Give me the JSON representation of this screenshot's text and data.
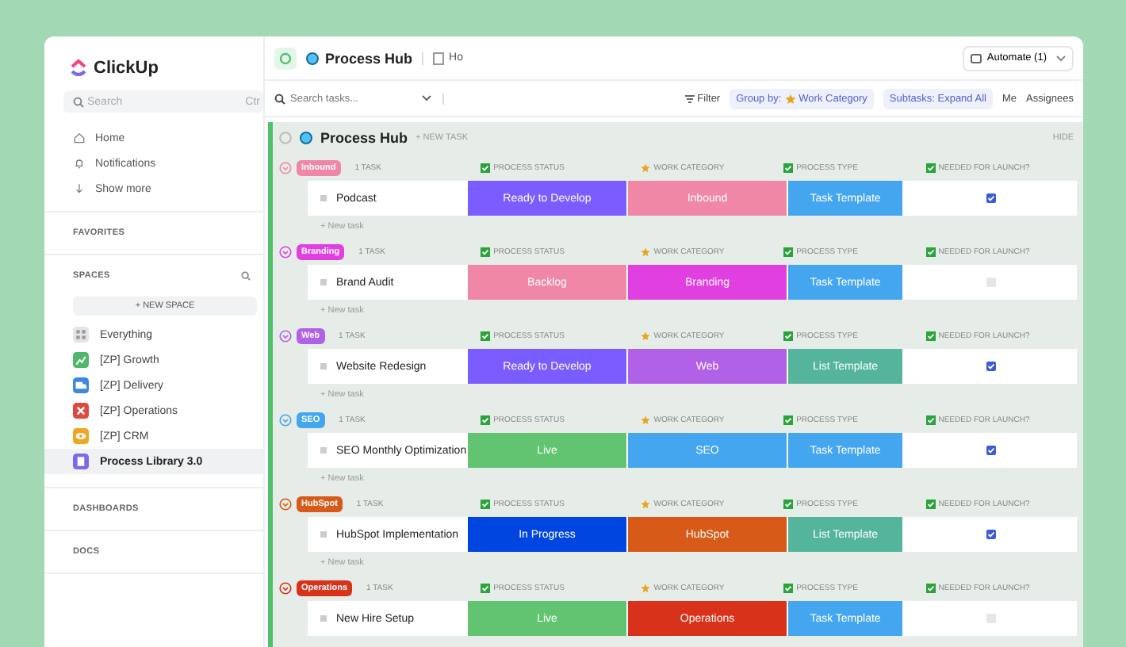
{
  "sidebar": {
    "logo": "ClickUp",
    "search": {
      "placeholder": "Search",
      "shortcut": "Ctr"
    },
    "nav": [
      {
        "kind": "home",
        "label": "Home"
      },
      {
        "kind": "bell",
        "label": "Notifications"
      },
      {
        "kind": "more",
        "label": "Show more"
      }
    ],
    "favorites_heading": "FAVORITES",
    "spaces_heading": "SPACES",
    "new_space": "+ NEW SPACE",
    "spaces": [
      {
        "kind": "grid",
        "label": "Everything",
        "color": "#e3e5ea",
        "selected": false
      },
      {
        "kind": "chart",
        "label": "[ZP] Growth",
        "color": "#4fb76b",
        "selected": false
      },
      {
        "kind": "truck",
        "label": "[ZP] Delivery",
        "color": "#3d88e0",
        "selected": false
      },
      {
        "kind": "cross",
        "label": "[ZP] Operations",
        "color": "#e0493f",
        "selected": false
      },
      {
        "kind": "eye",
        "label": "[ZP] CRM",
        "color": "#f0a623",
        "selected": false
      },
      {
        "kind": "doc",
        "label": "Process Library 3.0",
        "color": "#7b68ee",
        "selected": true
      }
    ],
    "dashboards_heading": "DASHBOARDS",
    "docs_heading": "DOCS"
  },
  "header": {
    "title": "Process Hub",
    "tab": "Ho",
    "automate": "Automate (1)"
  },
  "toolbar": {
    "search": {
      "placeholder": "Search tasks..."
    },
    "filter": "Filter",
    "group_by": {
      "label": "Group by:",
      "value": "Work Category"
    },
    "subtasks": "Subtasks: Expand All",
    "me": "Me",
    "assignees": "Assignees"
  },
  "list": {
    "title": "Process Hub",
    "new_task": "+ NEW TASK",
    "hide": "HIDE"
  },
  "groups": [
    {
      "name": "Inbound",
      "color": "#f087a7",
      "count": "1 TASK",
      "columns": [
        "PROCESS STATUS",
        "WORK CATEGORY",
        "PROCESS TYPE",
        "NEEDED FOR LAUNCH?"
      ],
      "tasks": [
        {
          "name": "Podcast",
          "status": {
            "label": "Ready to Develop",
            "color": "#7b5cff"
          },
          "category": {
            "label": "Inbound",
            "color": "#f087a7"
          },
          "type": {
            "label": "Task Template",
            "color": "#45a6f0"
          },
          "needed": true
        }
      ],
      "add": "+ New task"
    },
    {
      "name": "Branding",
      "color": "#e040e0",
      "count": "1 TASK",
      "columns": [
        "PROCESS STATUS",
        "WORK CATEGORY",
        "PROCESS TYPE",
        "NEEDED FOR LAUNCH?"
      ],
      "tasks": [
        {
          "name": "Brand Audit",
          "status": {
            "label": "Backlog",
            "color": "#f087a7"
          },
          "category": {
            "label": "Branding",
            "color": "#e040e0"
          },
          "type": {
            "label": "Task Template",
            "color": "#45a6f0"
          },
          "needed": false
        }
      ],
      "add": "+ New task"
    },
    {
      "name": "Web",
      "color": "#b061e8",
      "count": "1 TASK",
      "columns": [
        "PROCESS STATUS",
        "WORK CATEGORY",
        "PROCESS TYPE",
        "NEEDED FOR LAUNCH?"
      ],
      "tasks": [
        {
          "name": "Website Redesign",
          "status": {
            "label": "Ready to Develop",
            "color": "#7b5cff"
          },
          "category": {
            "label": "Web",
            "color": "#b061e8"
          },
          "type": {
            "label": "List Template",
            "color": "#55b59c"
          },
          "needed": true
        }
      ],
      "add": "+ New task"
    },
    {
      "name": "SEO",
      "color": "#45a6f0",
      "count": "1 TASK",
      "columns": [
        "PROCESS STATUS",
        "WORK CATEGORY",
        "PROCESS TYPE",
        "NEEDED FOR LAUNCH?"
      ],
      "tasks": [
        {
          "name": "SEO Monthly Optimization",
          "status": {
            "label": "Live",
            "color": "#62c370"
          },
          "category": {
            "label": "SEO",
            "color": "#45a6f0"
          },
          "type": {
            "label": "Task Template",
            "color": "#45a6f0"
          },
          "needed": true
        }
      ],
      "add": "+ New task"
    },
    {
      "name": "HubSpot",
      "color": "#d85a18",
      "count": "1 TASK",
      "columns": [
        "PROCESS STATUS",
        "WORK CATEGORY",
        "PROCESS TYPE",
        "NEEDED FOR LAUNCH?"
      ],
      "tasks": [
        {
          "name": "HubSpot Implementation",
          "status": {
            "label": "In Progress",
            "color": "#0045e0"
          },
          "category": {
            "label": "HubSpot",
            "color": "#d85a18"
          },
          "type": {
            "label": "List Template",
            "color": "#55b59c"
          },
          "needed": true
        }
      ],
      "add": "+ New task"
    },
    {
      "name": "Operations",
      "color": "#d8321a",
      "count": "1 TASK",
      "columns": [
        "PROCESS STATUS",
        "WORK CATEGORY",
        "PROCESS TYPE",
        "NEEDED FOR LAUNCH?"
      ],
      "tasks": [
        {
          "name": "New Hire Setup",
          "status": {
            "label": "Live",
            "color": "#62c370"
          },
          "category": {
            "label": "Operations",
            "color": "#d8321a"
          },
          "type": {
            "label": "Task Template",
            "color": "#45a6f0"
          },
          "needed": false
        }
      ]
    }
  ]
}
